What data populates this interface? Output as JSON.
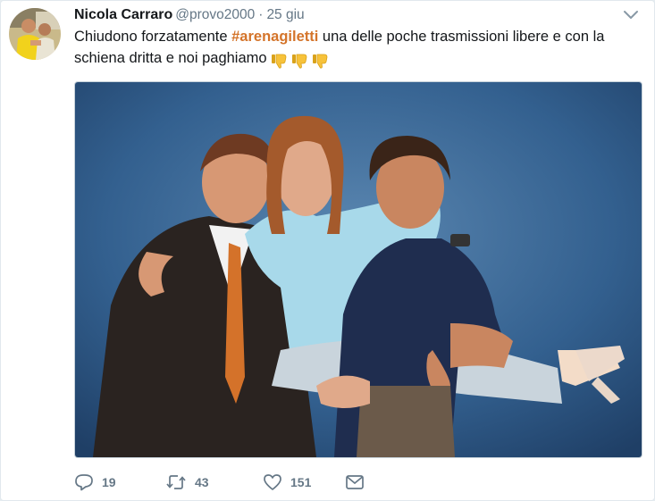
{
  "tweet": {
    "author_name": "Nicola Carraro",
    "handle": "@provo2000",
    "separator": "·",
    "date": "25 giu",
    "text_before": "Chiudono forzatamente ",
    "hashtag": "#arenagiletti",
    "text_after": " una delle poche trasmissioni libere e con la schiena dritta e noi paghiamo",
    "emojis": [
      "thumbs-down-icon",
      "thumbs-down-icon",
      "thumbs-down-icon"
    ],
    "media_description_icon": "photo-icon"
  },
  "actions": {
    "reply_count": "19",
    "retweet_count": "43",
    "like_count": "151"
  },
  "colors": {
    "hashtag": "#d4742a",
    "muted": "#657786",
    "text": "#14171a",
    "photo_backdrop": "#2f5a86"
  }
}
